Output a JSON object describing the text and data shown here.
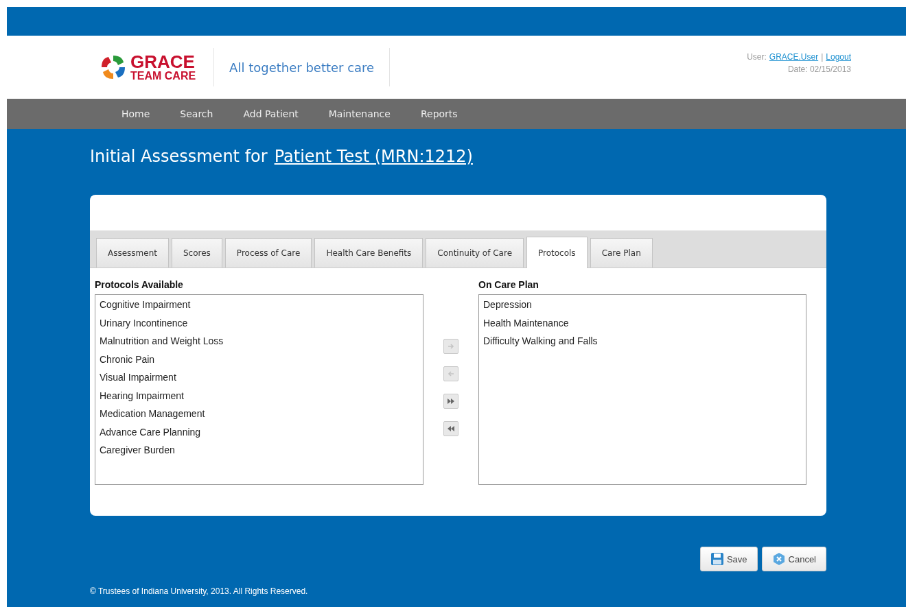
{
  "header": {
    "logo_line_1": "GRACE",
    "logo_line_2": "TEAM CARE",
    "tagline": "All together better care",
    "user_label": "User:",
    "user_link": "GRACE.User",
    "separator": "|",
    "logout": "Logout",
    "date": "Date: 02/15/2013"
  },
  "nav": [
    "Home",
    "Search",
    "Add Patient",
    "Maintenance",
    "Reports"
  ],
  "page_title": "Initial Assessment for",
  "patient_link": "Patient Test (MRN:1212)",
  "tabs": [
    {
      "label": "Assessment",
      "selected": false
    },
    {
      "label": "Scores",
      "selected": false
    },
    {
      "label": "Process of Care",
      "selected": false
    },
    {
      "label": "Health Care Benefits",
      "selected": false
    },
    {
      "label": "Continuity of Care",
      "selected": false
    },
    {
      "label": "Protocols",
      "selected": true
    },
    {
      "label": "Care Plan",
      "selected": false
    }
  ],
  "available": {
    "heading": "Protocols Available",
    "items": [
      "Cognitive Impairment",
      "Urinary Incontinence",
      "Malnutrition and Weight Loss",
      "Chronic Pain",
      "Visual Impairment",
      "Hearing Impairment",
      "Medication Management",
      "Advance Care Planning",
      "Caregiver Burden"
    ]
  },
  "transfer_buttons": [
    {
      "kind": "move-right",
      "disabled": true
    },
    {
      "kind": "move-left",
      "disabled": true
    },
    {
      "kind": "move-all-right",
      "disabled": false
    },
    {
      "kind": "move-all-left",
      "disabled": false
    }
  ],
  "care_plan": {
    "heading": "On Care Plan",
    "items": [
      "Depression",
      "Health Maintenance",
      "Difficulty Walking and Falls"
    ]
  },
  "buttons": [
    {
      "kind": "save",
      "label": "Save"
    },
    {
      "kind": "cancel",
      "label": "Cancel"
    }
  ],
  "footer": "© Trustees of Indiana University, 2013. All Rights Reserved."
}
